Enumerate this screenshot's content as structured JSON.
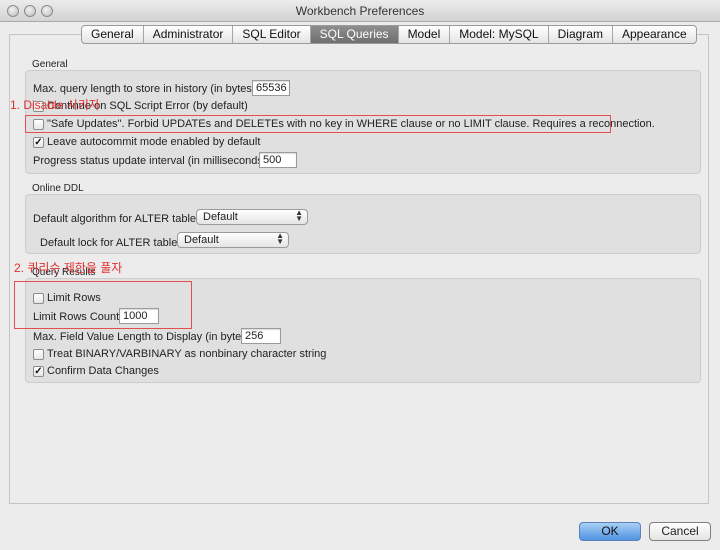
{
  "window": {
    "title": "Workbench Preferences"
  },
  "tabs": [
    "General",
    "Administrator",
    "SQL Editor",
    "SQL Queries",
    "Model",
    "Model: MySQL",
    "Diagram",
    "Appearance"
  ],
  "active_tab": "SQL Queries",
  "general": {
    "section_label": "General",
    "max_query_label": "Max. query length to store in history (in bytes):",
    "max_query_value": "65536",
    "continue_on_error_label": "Continue on SQL Script Error (by default)",
    "continue_on_error_checked": false,
    "safe_updates_label": "\"Safe Updates\". Forbid UPDATEs and DELETEs with no key in WHERE clause or no LIMIT clause. Requires a reconnection.",
    "safe_updates_checked": false,
    "autocommit_label": "Leave autocommit mode enabled by default",
    "autocommit_checked": true,
    "progress_label": "Progress status update interval (in milliseconds):",
    "progress_value": "500"
  },
  "online_ddl": {
    "section_label": "Online DDL",
    "algorithm_label": "Default algorithm for ALTER table:",
    "algorithm_value": "Default",
    "lock_label": "Default lock for ALTER table:",
    "lock_value": "Default"
  },
  "query_results": {
    "section_label": "Query Results",
    "limit_rows_label": "Limit Rows",
    "limit_rows_checked": false,
    "limit_rows_count_label": "Limit Rows Count:",
    "limit_rows_count_value": "1000",
    "max_field_label": "Max. Field Value Length to Display (in bytes):",
    "max_field_value": "256",
    "treat_binary_label": "Treat BINARY/VARBINARY as nonbinary character string",
    "treat_binary_checked": false,
    "confirm_changes_label": "Confirm Data Changes",
    "confirm_changes_checked": true
  },
  "annotations": {
    "note1": "1. Disable 시키자",
    "note2": "2. 퀴리수 제한을 풀자"
  },
  "buttons": {
    "ok": "OK",
    "cancel": "Cancel"
  },
  "colors": {
    "annotation": "#e03030",
    "active_tab": "#7a7a7a",
    "ok_button": "#4f93e1"
  },
  "icons": {
    "checked": "✓",
    "select_arrows": "up-down-arrows"
  }
}
